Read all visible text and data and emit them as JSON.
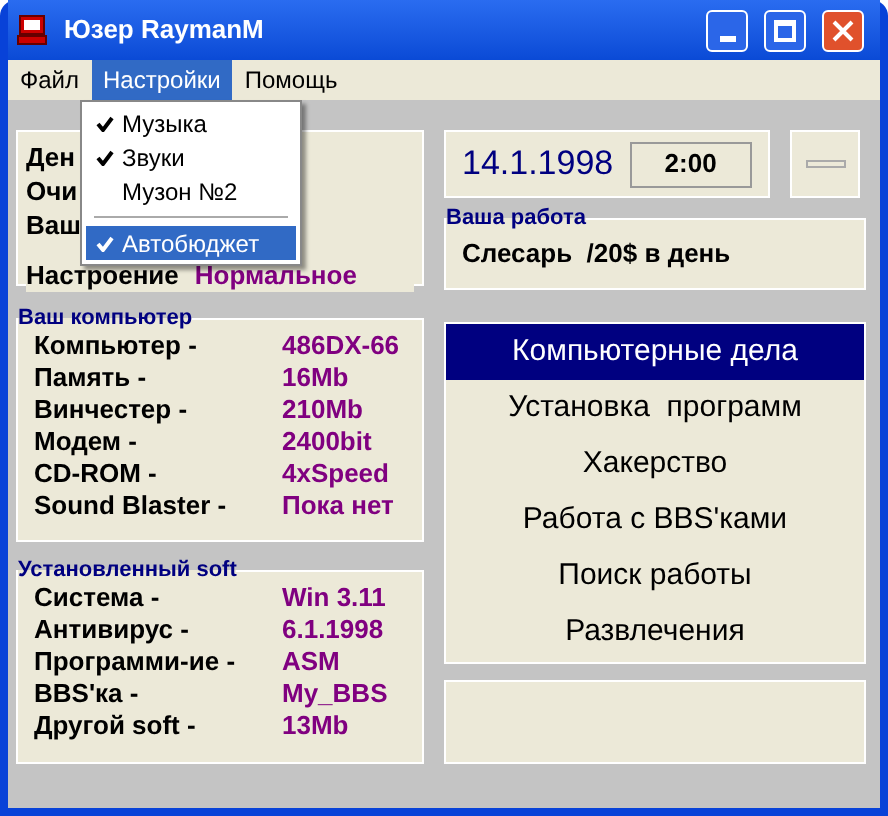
{
  "window": {
    "title": "Юзер RaymanM"
  },
  "menu_bar": [
    {
      "label": "Файл",
      "selected": false
    },
    {
      "label": "Настройки",
      "selected": true
    },
    {
      "label": "Помощь",
      "selected": false
    }
  ],
  "open_menu": {
    "items": [
      {
        "kind": "item",
        "label": "Музыка",
        "checked": true,
        "selected": false
      },
      {
        "kind": "item",
        "label": "Звуки",
        "checked": true,
        "selected": false
      },
      {
        "kind": "item",
        "label": "Музон №2",
        "checked": false,
        "selected": false
      },
      {
        "kind": "separator"
      },
      {
        "kind": "item",
        "label": "Автобюджет",
        "checked": true,
        "selected": true
      }
    ]
  },
  "status_panel": {
    "rows": [
      {
        "label": "Ден"
      },
      {
        "label": "Очи"
      },
      {
        "label": "Ваш"
      },
      {
        "label": "Настроение",
        "value": "Нормальное"
      }
    ]
  },
  "date": "14.1.1998",
  "time": "2:00",
  "job": {
    "title": "Ваша работа",
    "text": "Слесарь  /20$ в день"
  },
  "computer": {
    "title": "Ваш компьютер",
    "rows": [
      {
        "label": "Компьютер -",
        "value": "486DX-66"
      },
      {
        "label": "Память -",
        "value": "16Mb"
      },
      {
        "label": "Винчестер -",
        "value": "210Mb"
      },
      {
        "label": "Модем -",
        "value": "2400bit"
      },
      {
        "label": "CD-ROM -",
        "value": "4xSpeed"
      },
      {
        "label": "Sound Blaster -",
        "value": "Пока нет"
      }
    ]
  },
  "software": {
    "title": "Установленный soft",
    "rows": [
      {
        "label": "Система -",
        "value": "Win 3.11"
      },
      {
        "label": "Антивирус -",
        "value": "6.1.1998"
      },
      {
        "label": "Программи-ие -",
        "value": "ASM"
      },
      {
        "label": "BBS'ка -",
        "value": "My_BBS"
      },
      {
        "label": "Другой soft -",
        "value": "13Mb"
      }
    ]
  },
  "activities": [
    {
      "label": "Компьютерные дела",
      "selected": true
    },
    {
      "label": "Установка  программ",
      "selected": false
    },
    {
      "label": "Хакерство",
      "selected": false
    },
    {
      "label": "Работа с BBS'ками",
      "selected": false
    },
    {
      "label": "Поиск работы",
      "selected": false
    },
    {
      "label": "Развлечения",
      "selected": false
    }
  ]
}
